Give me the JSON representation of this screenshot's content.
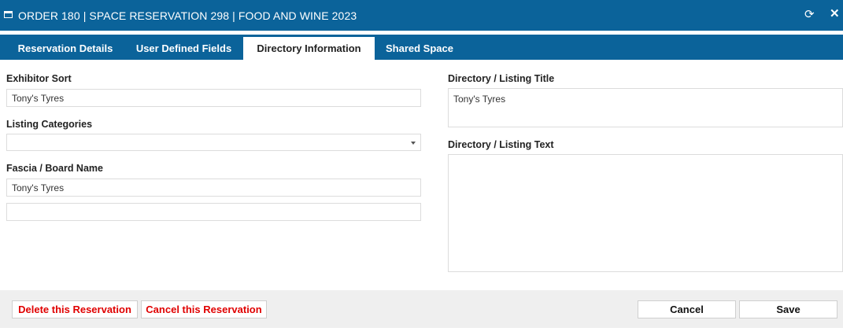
{
  "window": {
    "title": "ORDER 180 | SPACE RESERVATION 298 | FOOD AND WINE 2023",
    "refresh_glyph": "⟳",
    "close_glyph": "✕"
  },
  "tabs": [
    {
      "label": "Reservation Details",
      "active": false
    },
    {
      "label": "User Defined Fields",
      "active": false
    },
    {
      "label": "Directory Information",
      "active": true
    },
    {
      "label": "Shared Space",
      "active": false
    }
  ],
  "form": {
    "exhibitor_sort": {
      "label": "Exhibitor Sort",
      "value": "Tony's Tyres"
    },
    "listing_categories": {
      "label": "Listing Categories",
      "value": ""
    },
    "fascia_board_name": {
      "label": "Fascia / Board Name",
      "value": "Tony's Tyres",
      "value2": ""
    },
    "directory_listing_title": {
      "label": "Directory / Listing Title",
      "value": "Tony's Tyres"
    },
    "directory_listing_text": {
      "label": "Directory / Listing Text",
      "value": ""
    }
  },
  "footer": {
    "delete_label": "Delete this Reservation",
    "cancel_reservation_label": "Cancel this Reservation",
    "cancel_label": "Cancel",
    "save_label": "Save"
  },
  "colors": {
    "header_blue": "#0b639a",
    "danger_red": "#e00000",
    "footer_bg": "#efefef"
  }
}
